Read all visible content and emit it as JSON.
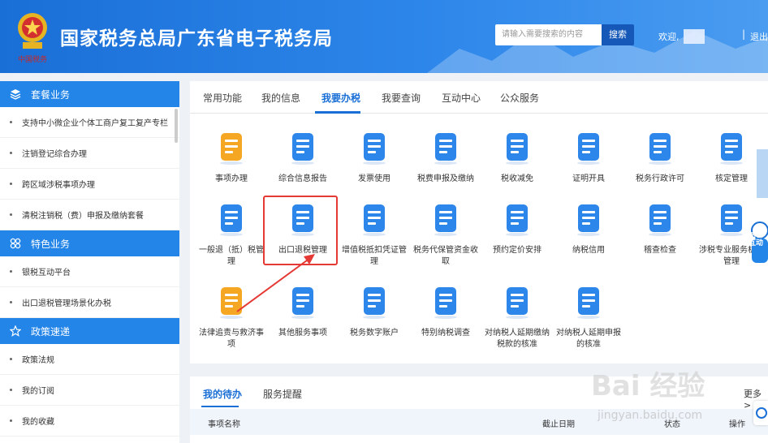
{
  "header": {
    "emblem_text": "中国税务",
    "title": "国家税务总局广东省电子税务局",
    "search_placeholder": "请输入需要搜索的内容",
    "search_button": "搜索",
    "welcome": "欢迎,",
    "divider": "|",
    "logout": "退出"
  },
  "sidebar": {
    "sections": [
      {
        "title": "套餐业务",
        "icon": "layers-icon",
        "items": [
          "支持中小微企业个体工商户复工复产专栏",
          "注销登记综合办理",
          "跨区域涉税事项办理",
          "清税注销税（费）申报及缴纳套餐"
        ]
      },
      {
        "title": "特色业务",
        "icon": "grid-icon",
        "items": [
          "银税互动平台",
          "出口退税管理场景化办税"
        ]
      },
      {
        "title": "政策速递",
        "icon": "star-icon",
        "items": [
          "政策法规",
          "我的订阅",
          "我的收藏"
        ]
      }
    ]
  },
  "tabs": [
    "常用功能",
    "我的信息",
    "我要办税",
    "我要查询",
    "互动中心",
    "公众服务"
  ],
  "active_tab": "我要办税",
  "functions": [
    {
      "label": "事项办理",
      "icon": "pen-icon"
    },
    {
      "label": "综合信息报告",
      "icon": "report-icon"
    },
    {
      "label": "发票使用",
      "icon": "invoice-icon"
    },
    {
      "label": "税费申报及缴纳",
      "icon": "tax-declare-icon"
    },
    {
      "label": "税收减免",
      "icon": "tax-relief-icon"
    },
    {
      "label": "证明开具",
      "icon": "certificate-icon"
    },
    {
      "label": "税务行政许可",
      "icon": "license-icon"
    },
    {
      "label": "核定管理",
      "icon": "verify-icon"
    },
    {
      "label": "一般退（抵）税管理",
      "icon": "refund-icon"
    },
    {
      "label": "出口退税管理",
      "icon": "export-refund-icon"
    },
    {
      "label": "增值税抵扣凭证管理",
      "icon": "vat-voucher-icon"
    },
    {
      "label": "税务代保管资金收取",
      "icon": "money-bag-icon"
    },
    {
      "label": "预约定价安排",
      "icon": "pricing-icon"
    },
    {
      "label": "纳税信用",
      "icon": "credit-icon"
    },
    {
      "label": "稽查检查",
      "icon": "inspect-icon"
    },
    {
      "label": "涉税专业服务机构管理",
      "icon": "agency-icon"
    },
    {
      "label": "法律追责与救济事项",
      "icon": "gavel-icon"
    },
    {
      "label": "其他服务事项",
      "icon": "other-service-icon"
    },
    {
      "label": "税务数字账户",
      "icon": "digital-account-icon"
    },
    {
      "label": "特别纳税调查",
      "icon": "special-investigation-icon"
    },
    {
      "label": "对纳税人延期缴纳税款的核准",
      "icon": "deferred-payment-icon"
    },
    {
      "label": "对纳税人延期申报的核准",
      "icon": "deferred-declare-icon"
    }
  ],
  "bottom": {
    "tabs": [
      "我的待办",
      "服务提醒"
    ],
    "more": "更多>",
    "columns": [
      "事项名称",
      "截止日期",
      "状态",
      "操作"
    ]
  },
  "floating": {
    "robot_text": "纳税互动"
  },
  "watermark": {
    "main": "Bai 经验",
    "sub": "jingyan.baidu.com"
  }
}
